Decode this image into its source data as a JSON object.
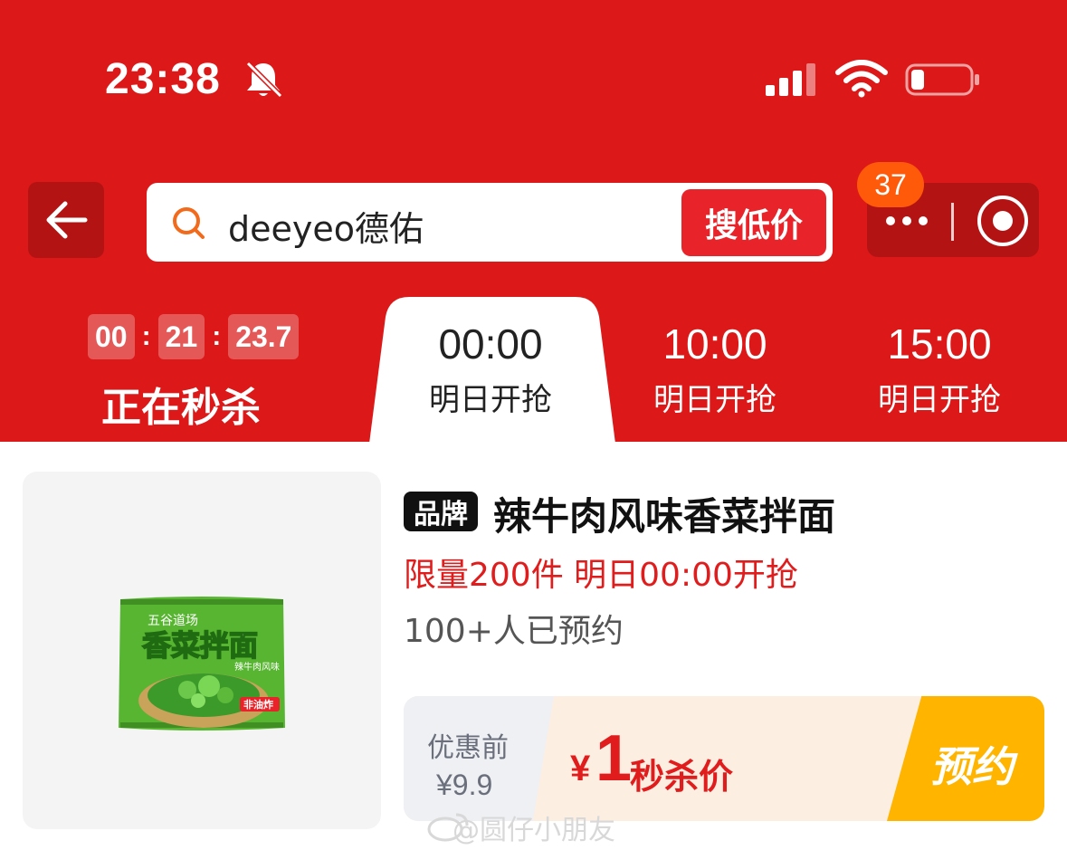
{
  "status_bar": {
    "time": "23:38",
    "icons": [
      "bell-off-icon",
      "signal-icon",
      "wifi-icon",
      "battery-low-icon"
    ]
  },
  "nav": {
    "back_icon": "arrow-left-icon",
    "search_query": "deeyeo德佑",
    "search_button": "搜低价",
    "notification_badge": "37",
    "menu_icons": [
      "more-dots-icon",
      "record-icon"
    ]
  },
  "time_tabs": {
    "countdown": {
      "hours": "00",
      "minutes": "21",
      "seconds": "23.7"
    },
    "now_label": "正在秒杀",
    "tabs": [
      {
        "time": "00:00",
        "label": "明日开抢",
        "active": true
      },
      {
        "time": "10:00",
        "label": "明日开抢",
        "active": false
      },
      {
        "time": "15:00",
        "label": "明日开抢",
        "active": false
      }
    ]
  },
  "product": {
    "brand_tag": "品牌",
    "title": "辣牛肉风味香菜拌面",
    "limit_text": "限量200件 明日00:00开抢",
    "reserved_text": "100+人已预约",
    "original_label": "优惠前",
    "original_price": "¥9.9",
    "sale_currency": "¥",
    "sale_price": "1",
    "sale_label": "秒杀价",
    "action_button": "预约",
    "package_text": {
      "brand": "五谷道场",
      "name": "香菜拌面",
      "flavor": "辣牛肉风味",
      "tag": "非油炸"
    }
  },
  "watermark": "@圆仔小朋友",
  "colors": {
    "primary_red": "#dc1818",
    "sale_red": "#e01c1c",
    "badge_orange": "#ff5a0a",
    "button_yellow": "#ffb400"
  }
}
